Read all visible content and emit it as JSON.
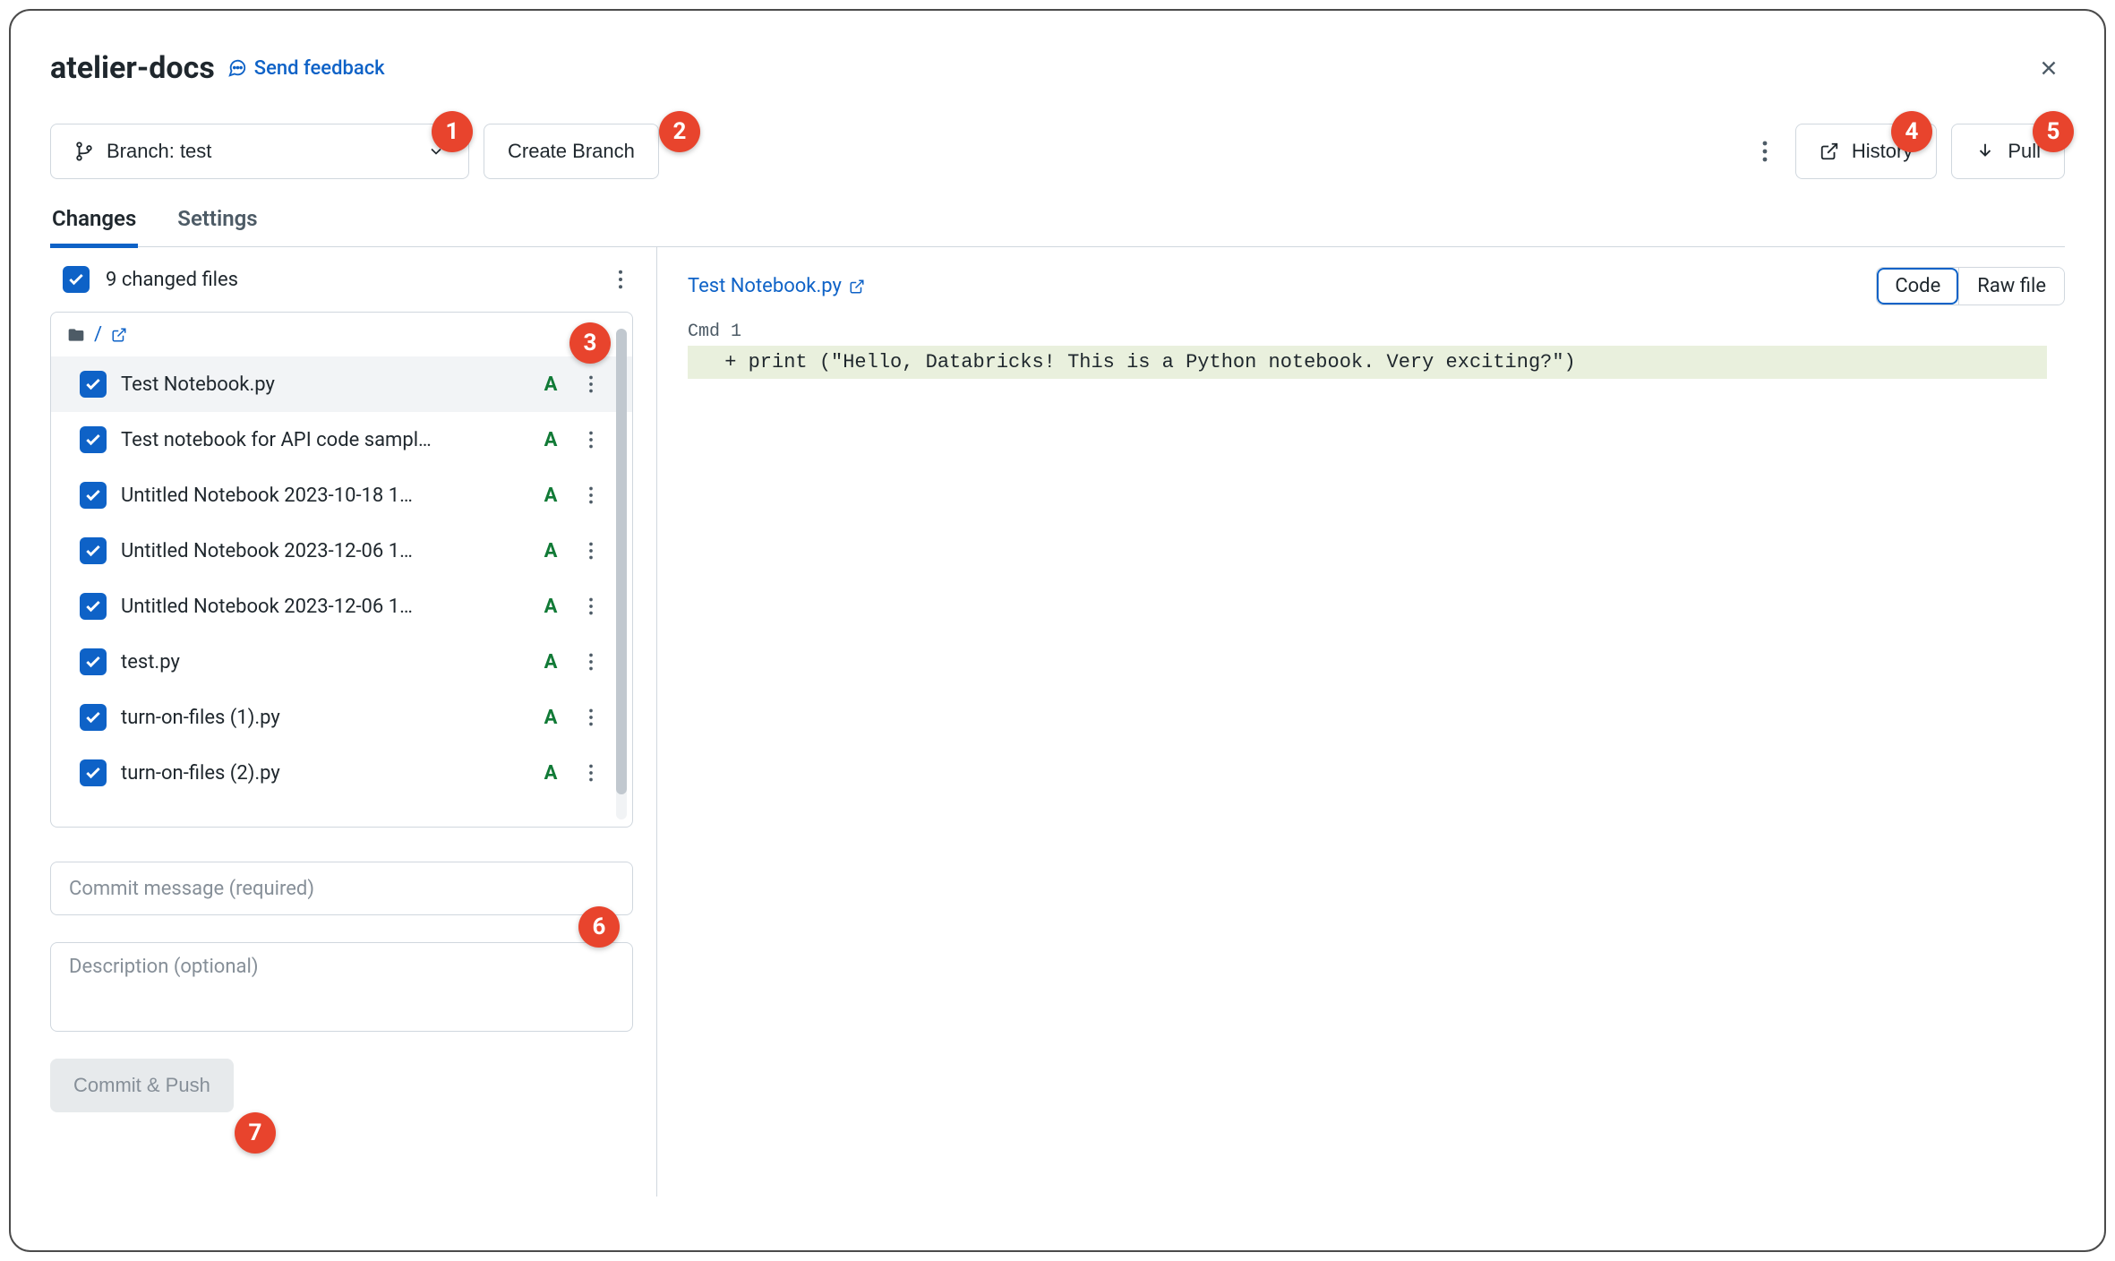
{
  "header": {
    "title": "atelier-docs",
    "feedback": "Send feedback"
  },
  "toolbar": {
    "branch_prefix": "Branch: ",
    "branch_name": "test",
    "create_branch": "Create Branch",
    "history": "History",
    "pull": "Pull"
  },
  "tabs": {
    "changes": "Changes",
    "settings": "Settings"
  },
  "changes": {
    "summary": "9 changed files",
    "root_path": "/",
    "files": [
      {
        "name": "Test Notebook.py",
        "status": "A",
        "selected": true
      },
      {
        "name": "Test notebook for API code sampl…",
        "status": "A",
        "selected": false
      },
      {
        "name": "Untitled Notebook 2023-10-18 1…",
        "status": "A",
        "selected": false
      },
      {
        "name": "Untitled Notebook 2023-12-06 1…",
        "status": "A",
        "selected": false
      },
      {
        "name": "Untitled Notebook 2023-12-06 1…",
        "status": "A",
        "selected": false
      },
      {
        "name": "test.py",
        "status": "A",
        "selected": false
      },
      {
        "name": "turn-on-files (1).py",
        "status": "A",
        "selected": false
      },
      {
        "name": "turn-on-files (2).py",
        "status": "A",
        "selected": false
      }
    ]
  },
  "commit": {
    "message_placeholder": "Commit message (required)",
    "description_placeholder": "Description (optional)",
    "button": "Commit & Push"
  },
  "diff": {
    "file": "Test Notebook.py",
    "view_code": "Code",
    "view_raw": "Raw file",
    "cmd_label": "Cmd 1",
    "added_line": " + print (\"Hello, Databricks! This is a Python notebook. Very exciting?\")"
  },
  "badges": [
    "1",
    "2",
    "3",
    "4",
    "5",
    "6",
    "7"
  ]
}
